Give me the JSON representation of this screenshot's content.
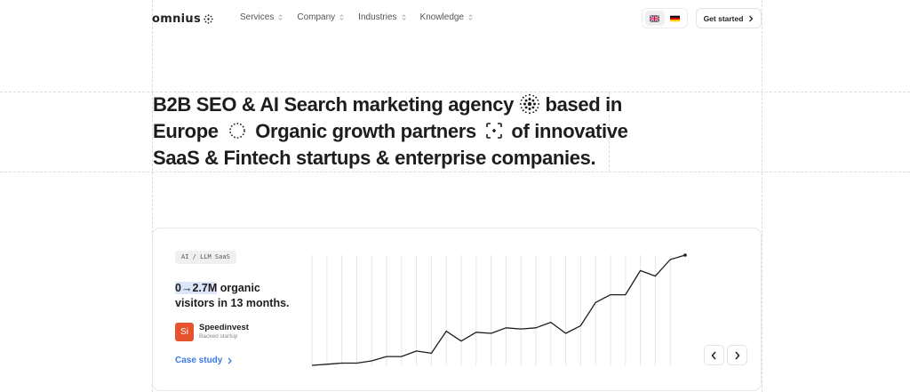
{
  "header": {
    "logo_text": "omnius",
    "nav": [
      {
        "label": "Services"
      },
      {
        "label": "Company"
      },
      {
        "label": "Industries"
      },
      {
        "label": "Knowledge"
      }
    ],
    "languages": [
      {
        "code": "en",
        "icon": "uk-flag-icon",
        "active": true
      },
      {
        "code": "de",
        "icon": "germany-flag-icon",
        "active": false
      }
    ],
    "cta_label": "Get started"
  },
  "hero": {
    "line1_a": "B2B SEO & AI Search marketing agency",
    "line1_b": "based in",
    "line2_a": "Europe",
    "line2_b": "Organic growth partners",
    "line2_c": "of innovative",
    "line3": "SaaS & Fintech startups & enterprise companies."
  },
  "case_card": {
    "tag": "AI / LLM SaaS",
    "stat_highlight": "0→2.7M",
    "stat_rest": " organic visitors in 13 months.",
    "company_initials": "Si",
    "company_name": "Speedinvest",
    "company_sub": "Backed startup",
    "link_label": "Case study",
    "colors": {
      "link": "#3a7be8",
      "highlight": "#dbe6f8",
      "company_logo": "#e8532f"
    }
  },
  "chart_data": {
    "type": "line",
    "xlabel": "",
    "ylabel": "",
    "grid": "vertical",
    "x": [
      0,
      1,
      2,
      3,
      4,
      5,
      6,
      7,
      8,
      9,
      10,
      11,
      12,
      13,
      14,
      15,
      16,
      17,
      18,
      19,
      20,
      21,
      22,
      23,
      24
    ],
    "y": [
      0.0,
      0.01,
      0.02,
      0.02,
      0.04,
      0.08,
      0.08,
      0.13,
      0.11,
      0.31,
      0.22,
      0.3,
      0.29,
      0.34,
      0.33,
      0.34,
      0.39,
      0.29,
      0.36,
      0.57,
      0.64,
      0.64,
      0.86,
      0.81,
      0.96,
      1.0
    ],
    "ylim": [
      0,
      1
    ]
  }
}
